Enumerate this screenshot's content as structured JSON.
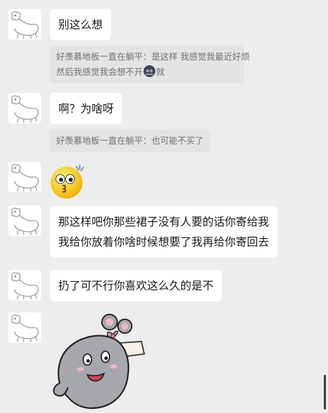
{
  "messages": [
    {
      "text": "别这么想"
    },
    {
      "quote_lines": [
        "好羡慕地板一直在躺平：是这样 我感觉我最近好烦",
        "然后我感觉我会想不开",
        "就"
      ]
    },
    {
      "text": "啊？为啥呀"
    },
    {
      "quote": "好羡慕地板一直在躺平：也可能不买了"
    },
    {
      "sticker": "surprised-face-emoji"
    },
    {
      "lines": [
        "那这样吧你那些裙子没有人要的话你寄给我",
        "我给你放着你啥时候想要了我再给你寄回去"
      ]
    },
    {
      "text": "扔了可不行你喜欢这么久的是不"
    },
    {
      "sticker": "gray-mouse-sticker"
    }
  ],
  "colors": {
    "background": "#ededed",
    "bubble": "#ffffff",
    "quote_bg": "#e4e4e4",
    "quote_text": "#707070"
  }
}
